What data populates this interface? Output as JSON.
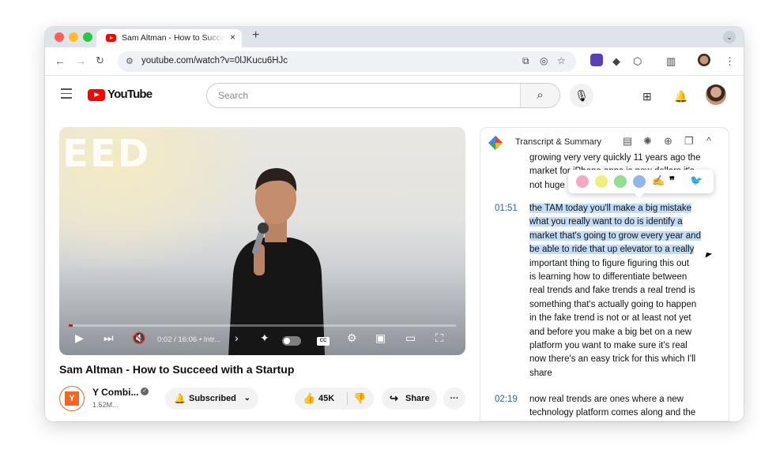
{
  "browser": {
    "tab_title": "Sam Altman - How to Succeed with a Startup",
    "tab_close": "×",
    "new_tab": "+",
    "url": "youtube.com/watch?v=0lJKucu6HJc",
    "tab_menu": "⌄"
  },
  "youtube": {
    "logo_text": "YouTube",
    "search_placeholder": "Search"
  },
  "video": {
    "overlay_text": "EED",
    "time": "0:02 / 16:06",
    "chapter": "• Intr...",
    "progress": 0.01,
    "title": "Sam Altman - How to Succeed with a Startup"
  },
  "channel": {
    "name": "Y Combi...",
    "subs": "1.52M...",
    "avatar_letter": "Y",
    "subscribed": "Subscribed",
    "likes": "45K",
    "share": "Share",
    "more": "···"
  },
  "panel": {
    "title": "Transcript & Summary"
  },
  "transcript": [
    {
      "time": "",
      "lines": [
        "growing very very quickly 11 years ago the",
        "market for iPhone apps is now dollars it's",
        "not huge"
      ]
    },
    {
      "time": "01:51",
      "highlighted_lines": [
        "the TAM today you'll make a big mistake",
        "what you really want to do is identify a",
        "market that's going to grow every year and",
        "be able to ride that up elevator to a really"
      ],
      "lines": [
        "important thing to figure figuring this out",
        "is learning how to differentiate between",
        "real trends and fake trends a real trend is",
        "something that's actually going to happen",
        "in the fake trend is not or at least not yet",
        "and before you make a big bet on a new",
        "platform you want to make sure it's real",
        "now there's an easy trick for this which I'll",
        "share"
      ]
    },
    {
      "time": "02:19",
      "lines": [
        "now real trends are ones where a new",
        "technology platform comes along and the"
      ]
    }
  ],
  "highlight_colors": [
    "#f7a8c4",
    "#f1ee7a",
    "#8fe08f",
    "#8fb8ee"
  ],
  "accent": {
    "youtube_red": "#ff0000",
    "timestamp_blue": "#1a66c8",
    "selection": "#c3dcf7"
  }
}
